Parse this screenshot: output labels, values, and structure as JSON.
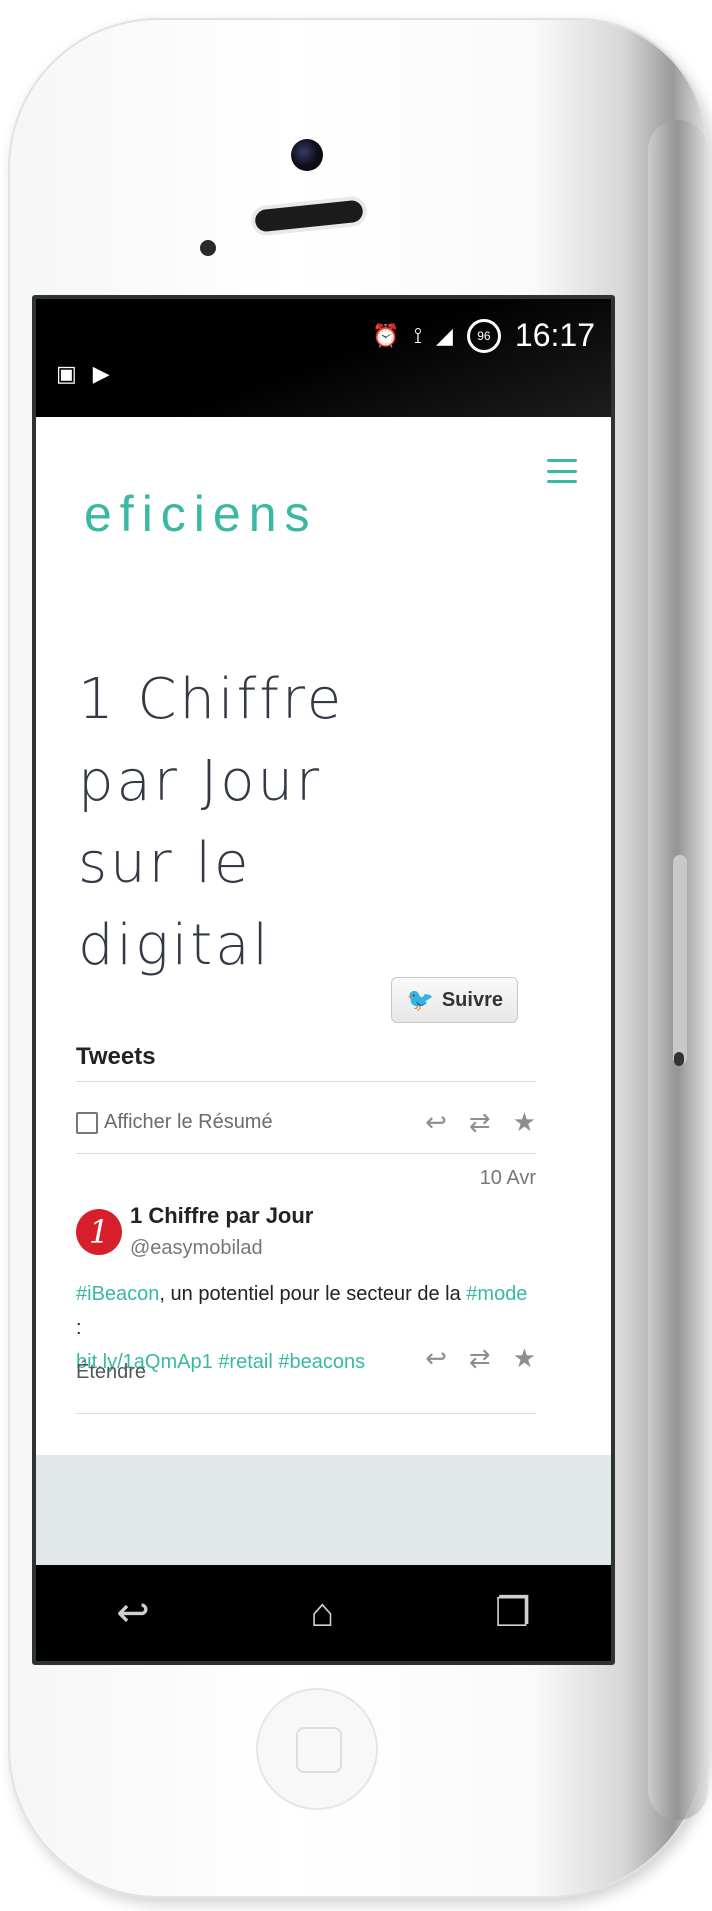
{
  "status_bar": {
    "time": "16:17",
    "battery": "96",
    "left_icons": [
      "image-icon",
      "shopping-bag-icon"
    ],
    "right_icons": [
      "alarm-icon",
      "wifi-icon",
      "signal-icon",
      "battery-icon"
    ]
  },
  "header": {
    "logo": "eficiens",
    "menu_icon": "hamburger-menu-icon"
  },
  "main": {
    "title": "1 Chiffre par Jour sur le digital"
  },
  "twitter_widget": {
    "follow_label": "Suivre",
    "title": "Tweets",
    "summary_label": "Afficher le Résumé",
    "tweet": {
      "date": "10 Avr",
      "author": "1 Chiffre par Jour",
      "handle": "@easymobilad",
      "avatar_text": "1",
      "text_parts": [
        "#iBeacon",
        ", un potentiel pour le secteur de la ",
        "#mode",
        " :",
        "bit.ly/1aQmAp1",
        "#retail",
        "#beacons"
      ],
      "expand_label": "Étendre"
    }
  },
  "nav_bar": {
    "back_icon": "back-icon",
    "home_icon": "home-icon",
    "recent_icon": "recent-apps-icon"
  },
  "colors": {
    "accent": "#39b9a2",
    "title_text": "#333a45",
    "footer_band": "#e2e7ea"
  }
}
